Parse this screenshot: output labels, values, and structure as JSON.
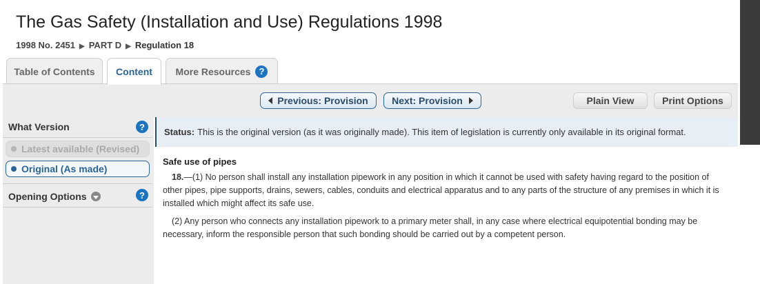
{
  "header": {
    "title": "The Gas Safety (Installation and Use) Regulations 1998",
    "breadcrumb": [
      "1998 No. 2451",
      "PART D",
      "Regulation 18"
    ]
  },
  "tabs": [
    {
      "label": "Table of Contents",
      "active": false
    },
    {
      "label": "Content",
      "active": true
    },
    {
      "label": "More Resources",
      "active": false,
      "icon": "help-icon"
    }
  ],
  "toolbar": {
    "previous_label": "Previous: Provision",
    "next_label": "Next: Provision",
    "plain_view_label": "Plain View",
    "print_options_label": "Print Options"
  },
  "sidebar": {
    "what_version_heading": "What Version",
    "versions": [
      {
        "label": "Latest available (Revised)",
        "state": "disabled"
      },
      {
        "label": "Original (As made)",
        "state": "selected"
      }
    ],
    "opening_options_heading": "Opening Options",
    "help_glyph": "?"
  },
  "status": {
    "label": "Status:",
    "text": "This is the original version (as it was originally made). This item of legislation is currently only available in its original format."
  },
  "content": {
    "heading": "Safe use of pipes",
    "para1_number": "18.",
    "para1_text": "—(1) No person shall install any installation pipework in any position in which it cannot be used with safety having regard to the position of other pipes, pipe supports, drains, sewers, cables, conduits and electrical apparatus and to any parts of the structure of any premises in which it is installed which might affect its safe use.",
    "para2_text": "(2) Any person who connects any installation pipework to a primary meter shall, in any case where electrical equipotential bonding may be necessary, inform the responsible person that such bonding should be carried out by a competent person."
  },
  "colors": {
    "accent": "#2a6496",
    "help_icon": "#1b74c2",
    "status_bg": "#e7eef6",
    "sidebar_bg": "#ececec"
  }
}
